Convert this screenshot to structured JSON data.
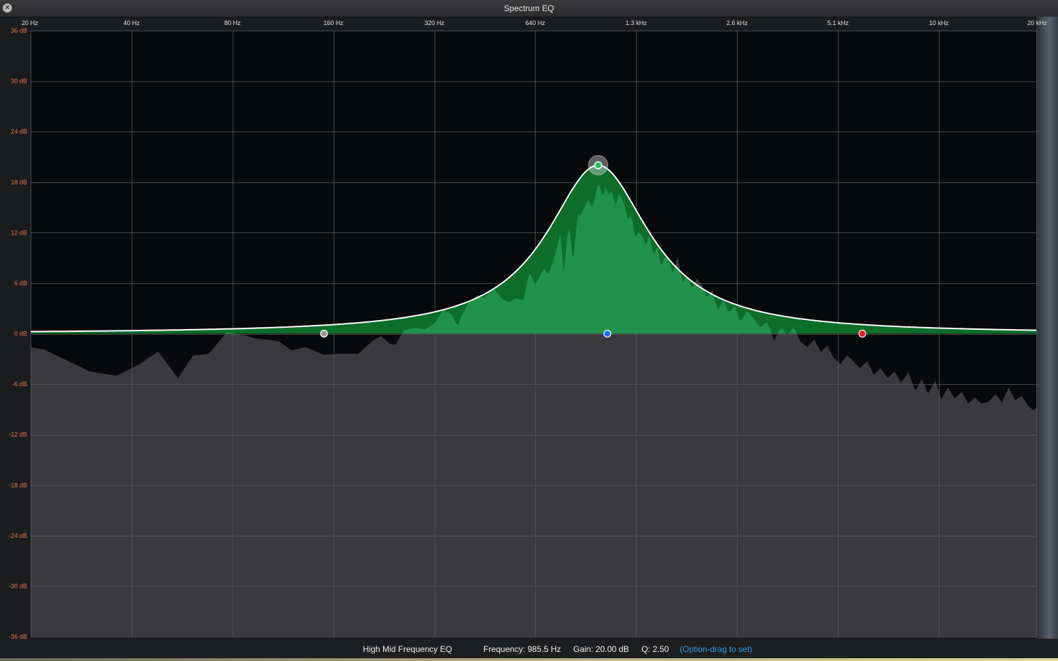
{
  "window": {
    "title": "Spectrum EQ",
    "close_icon": "close-icon"
  },
  "axis": {
    "x_ticks": [
      "20 Hz",
      "40 Hz",
      "80 Hz",
      "160 Hz",
      "320 Hz",
      "640 Hz",
      "1.3 kHz",
      "2.6 kHz",
      "5.1 kHz",
      "10 kHz",
      "20 kHz"
    ],
    "y_ticks": [
      "36 dB",
      "30 dB",
      "24 dB",
      "18 dB",
      "12 dB",
      "6 dB",
      "0 dB",
      "-6 dB",
      "-12 dB",
      "-18 dB",
      "-24 dB",
      "-30 dB",
      "-36 dB"
    ],
    "y_label_color": "#e8764a",
    "x_label_color": "#e6e6e6"
  },
  "colors": {
    "plot_bg": "#08090b",
    "analyzer_fill": "#3a3a3c",
    "eq_fill": "#0d6e2a",
    "spectrum_fill": "#21924a",
    "curve": "#ffffff",
    "grid": "#5a5c5e",
    "handle_low": "#9a9a9a",
    "handle_peak": "#22c552",
    "handle_center": "#1c6ff0",
    "handle_high": "#e81b2a",
    "hint": "#2f9fe8"
  },
  "eq": {
    "band_name": "High Mid Frequency EQ",
    "frequency_hz": 985.5,
    "gain_db": 20.0,
    "q": 2.5,
    "frequency_text": "Frequency: 985.5 Hz",
    "gain_text": "Gain: 20.00 dB",
    "q_text": "Q: 2.50",
    "hint_text": "(Option-drag to set)",
    "handles": [
      {
        "name": "low-band-handle",
        "freq_hz": 150,
        "gain_db": 0
      },
      {
        "name": "center-band-handle",
        "freq_hz": 1050,
        "gain_db": 0
      },
      {
        "name": "high-band-handle",
        "freq_hz": 6050,
        "gain_db": 0
      }
    ]
  },
  "analyzer": {
    "points": [
      [
        20,
        -1.6
      ],
      [
        22,
        -1.9
      ],
      [
        26,
        -3.3
      ],
      [
        30,
        -4.5
      ],
      [
        36,
        -5.0
      ],
      [
        42,
        -3.7
      ],
      [
        48,
        -2.1
      ],
      [
        55,
        -5.3
      ],
      [
        61,
        -2.6
      ],
      [
        68,
        -2.4
      ],
      [
        77,
        0.2
      ],
      [
        87,
        -0.2
      ],
      [
        94,
        -0.6
      ],
      [
        102,
        -0.7
      ],
      [
        110,
        -0.9
      ],
      [
        120,
        -2.0
      ],
      [
        132,
        -1.6
      ],
      [
        150,
        -2.5
      ],
      [
        165,
        -2.4
      ],
      [
        190,
        -2.4
      ],
      [
        210,
        -0.8
      ],
      [
        222,
        -0.3
      ],
      [
        236,
        -1.2
      ],
      [
        245,
        -1.3
      ],
      [
        260,
        0.4
      ],
      [
        280,
        0.7
      ],
      [
        300,
        0.5
      ],
      [
        320,
        1.2
      ],
      [
        340,
        2.8
      ],
      [
        360,
        2.3
      ],
      [
        375,
        0.9
      ],
      [
        385,
        2.0
      ],
      [
        405,
        3.7
      ],
      [
        430,
        4.6
      ],
      [
        450,
        4.2
      ],
      [
        480,
        5.4
      ],
      [
        510,
        4.1
      ],
      [
        535,
        3.7
      ],
      [
        560,
        4.2
      ],
      [
        590,
        4.0
      ],
      [
        615,
        7.3
      ],
      [
        640,
        5.8
      ],
      [
        660,
        6.8
      ],
      [
        680,
        7.8
      ],
      [
        700,
        7.0
      ],
      [
        720,
        8.4
      ],
      [
        740,
        9.9
      ],
      [
        760,
        12.0
      ],
      [
        780,
        6.8
      ],
      [
        795,
        11.3
      ],
      [
        810,
        12.8
      ],
      [
        830,
        8.1
      ],
      [
        845,
        11.9
      ],
      [
        860,
        14.4
      ],
      [
        875,
        13.9
      ],
      [
        890,
        14.8
      ],
      [
        905,
        15.2
      ],
      [
        920,
        16.0
      ],
      [
        945,
        15.0
      ],
      [
        970,
        16.4
      ],
      [
        985,
        18.0
      ],
      [
        1000,
        17.3
      ],
      [
        1020,
        16.1
      ],
      [
        1040,
        17.6
      ],
      [
        1060,
        16.4
      ],
      [
        1080,
        17.1
      ],
      [
        1110,
        15.2
      ],
      [
        1140,
        16.7
      ],
      [
        1180,
        15.3
      ],
      [
        1210,
        13.4
      ],
      [
        1240,
        14.2
      ],
      [
        1270,
        11.3
      ],
      [
        1300,
        12.1
      ],
      [
        1340,
        11.5
      ],
      [
        1370,
        10.4
      ],
      [
        1400,
        11.8
      ],
      [
        1440,
        9.3
      ],
      [
        1480,
        10.4
      ],
      [
        1520,
        7.9
      ],
      [
        1560,
        9.3
      ],
      [
        1600,
        8.7
      ],
      [
        1650,
        7.1
      ],
      [
        1700,
        9.1
      ],
      [
        1760,
        6.1
      ],
      [
        1820,
        6.8
      ],
      [
        1880,
        5.3
      ],
      [
        1940,
        6.6
      ],
      [
        2000,
        5.9
      ],
      [
        2080,
        4.3
      ],
      [
        2160,
        5.2
      ],
      [
        2240,
        2.8
      ],
      [
        2330,
        4.0
      ],
      [
        2420,
        2.5
      ],
      [
        2520,
        3.3
      ],
      [
        2620,
        1.4
      ],
      [
        2740,
        2.7
      ],
      [
        2860,
        1.9
      ],
      [
        3000,
        0.7
      ],
      [
        3150,
        1.4
      ],
      [
        3300,
        -0.8
      ],
      [
        3460,
        0.7
      ],
      [
        3620,
        -0.1
      ],
      [
        3780,
        0.8
      ],
      [
        3950,
        -0.9
      ],
      [
        4150,
        -1.6
      ],
      [
        4350,
        -0.7
      ],
      [
        4550,
        -2.2
      ],
      [
        4750,
        -1.4
      ],
      [
        4950,
        -2.8
      ],
      [
        5200,
        -3.6
      ],
      [
        5450,
        -2.6
      ],
      [
        5700,
        -3.3
      ],
      [
        5950,
        -4.1
      ],
      [
        6250,
        -3.3
      ],
      [
        6550,
        -4.9
      ],
      [
        6850,
        -4.1
      ],
      [
        7200,
        -5.3
      ],
      [
        7550,
        -4.5
      ],
      [
        7900,
        -5.8
      ],
      [
        8300,
        -4.6
      ],
      [
        8700,
        -6.8
      ],
      [
        9100,
        -5.4
      ],
      [
        9500,
        -7.1
      ],
      [
        10000,
        -5.6
      ],
      [
        10400,
        -7.8
      ],
      [
        10900,
        -6.4
      ],
      [
        11400,
        -7.7
      ],
      [
        12000,
        -6.9
      ],
      [
        12500,
        -8.3
      ],
      [
        13100,
        -7.6
      ],
      [
        13700,
        -8.3
      ],
      [
        14400,
        -8.1
      ],
      [
        15100,
        -7.2
      ],
      [
        15800,
        -8.2
      ],
      [
        16500,
        -6.4
      ],
      [
        17300,
        -7.9
      ],
      [
        18100,
        -7.4
      ],
      [
        18900,
        -8.6
      ],
      [
        19600,
        -9.1
      ],
      [
        20000,
        -8.8
      ]
    ]
  }
}
